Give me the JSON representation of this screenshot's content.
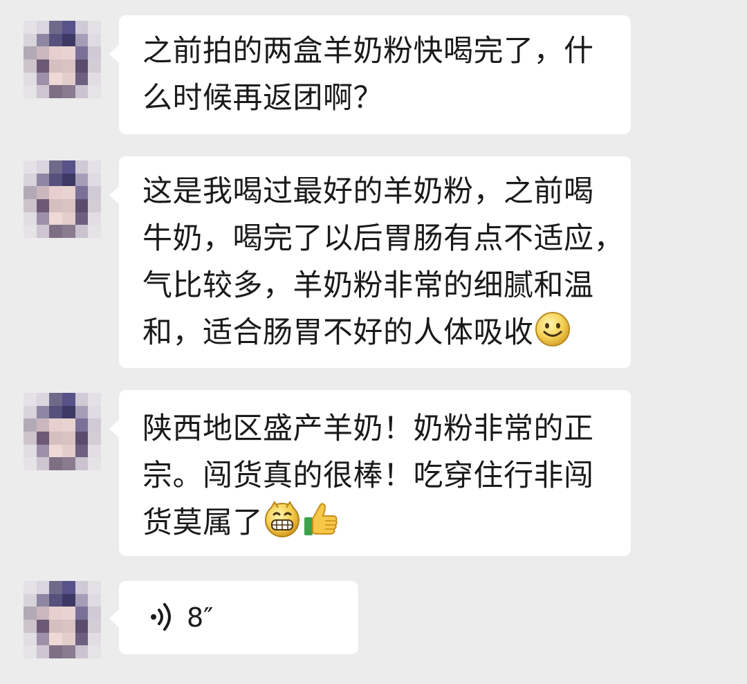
{
  "messages": [
    {
      "type": "text",
      "lines": [
        "之前拍的两盒羊奶粉快喝完了，什",
        "么时候再返团啊？"
      ]
    },
    {
      "type": "text",
      "lines": [
        "这是我喝过最好的羊奶粉，之前喝",
        "牛奶，喝完了以后胃肠有点不适应，",
        "气比较多，羊奶粉非常的细腻和温",
        "和，适合肠胃不好的人体吸收"
      ],
      "trailing_icons": [
        "smile-emoji-icon"
      ]
    },
    {
      "type": "text",
      "lines": [
        "陕西地区盛产羊奶！奶粉非常的正",
        "宗。闯货真的很棒！吃穿住行非闯",
        "货莫属了"
      ],
      "trailing_icons": [
        "grin-emoji-icon",
        "thumbs-up-emoji-icon"
      ]
    },
    {
      "type": "voice",
      "duration": "8″",
      "icon": "voice-wave-icon"
    }
  ]
}
